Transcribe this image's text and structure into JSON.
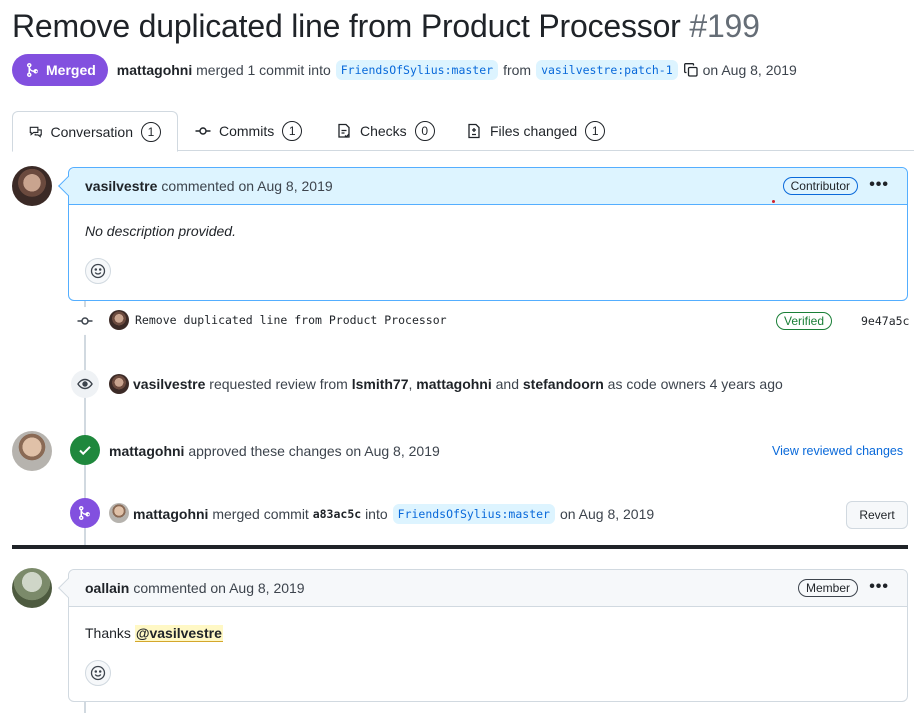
{
  "pr": {
    "title": "Remove duplicated line from Product Processor",
    "number": "#199",
    "state": "Merged",
    "author": "mattagohni",
    "merged_text": "merged 1 commit into",
    "base_branch": "FriendsOfSylius:master",
    "from_text": "from",
    "head_branch": "vasilvestre:patch-1",
    "date_text": "on Aug 8, 2019"
  },
  "tabs": [
    {
      "label": "Conversation",
      "count": "1"
    },
    {
      "label": "Commits",
      "count": "1"
    },
    {
      "label": "Checks",
      "count": "0"
    },
    {
      "label": "Files changed",
      "count": "1"
    }
  ],
  "comment1": {
    "author": "vasilvestre",
    "action": "commented on Aug 8, 2019",
    "badge": "Contributor",
    "body": "No description provided."
  },
  "commit": {
    "message": "Remove duplicated line from Product Processor",
    "verified": "Verified",
    "sha": "9e47a5c"
  },
  "review_request": {
    "author": "vasilvestre",
    "text1": "requested review from",
    "user1": "lsmith77",
    "sep": ",",
    "user2": "mattagohni",
    "and_text": "and",
    "user3": "stefandoorn",
    "text2": "as code owners 4 years ago"
  },
  "approval": {
    "author": "mattagohni",
    "text": "approved these changes on Aug 8, 2019",
    "link": "View reviewed changes"
  },
  "merge_event": {
    "author": "mattagohni",
    "text1": "merged commit",
    "sha": "a83ac5c",
    "text2": "into",
    "branch": "FriendsOfSylius:master",
    "date": "on Aug 8, 2019",
    "revert": "Revert"
  },
  "comment2": {
    "author": "oallain",
    "action": "commented on Aug 8, 2019",
    "badge": "Member",
    "body_prefix": "Thanks",
    "mention": "@vasilvestre"
  },
  "icons": {
    "merged": "git-merge-icon",
    "conversation": "comment-discussion-icon",
    "commits": "git-commit-icon",
    "checks": "checklist-icon",
    "files": "file-diff-icon",
    "copy": "copy-icon",
    "kebab": "kebab-horizontal-icon",
    "emoji": "smiley-icon",
    "eye": "eye-icon",
    "check": "check-icon"
  },
  "colors": {
    "merged_purple": "#8250df",
    "approved_green": "#1f883d",
    "link_blue": "#0969da",
    "highlight_blue_bg": "#ddf4ff"
  }
}
